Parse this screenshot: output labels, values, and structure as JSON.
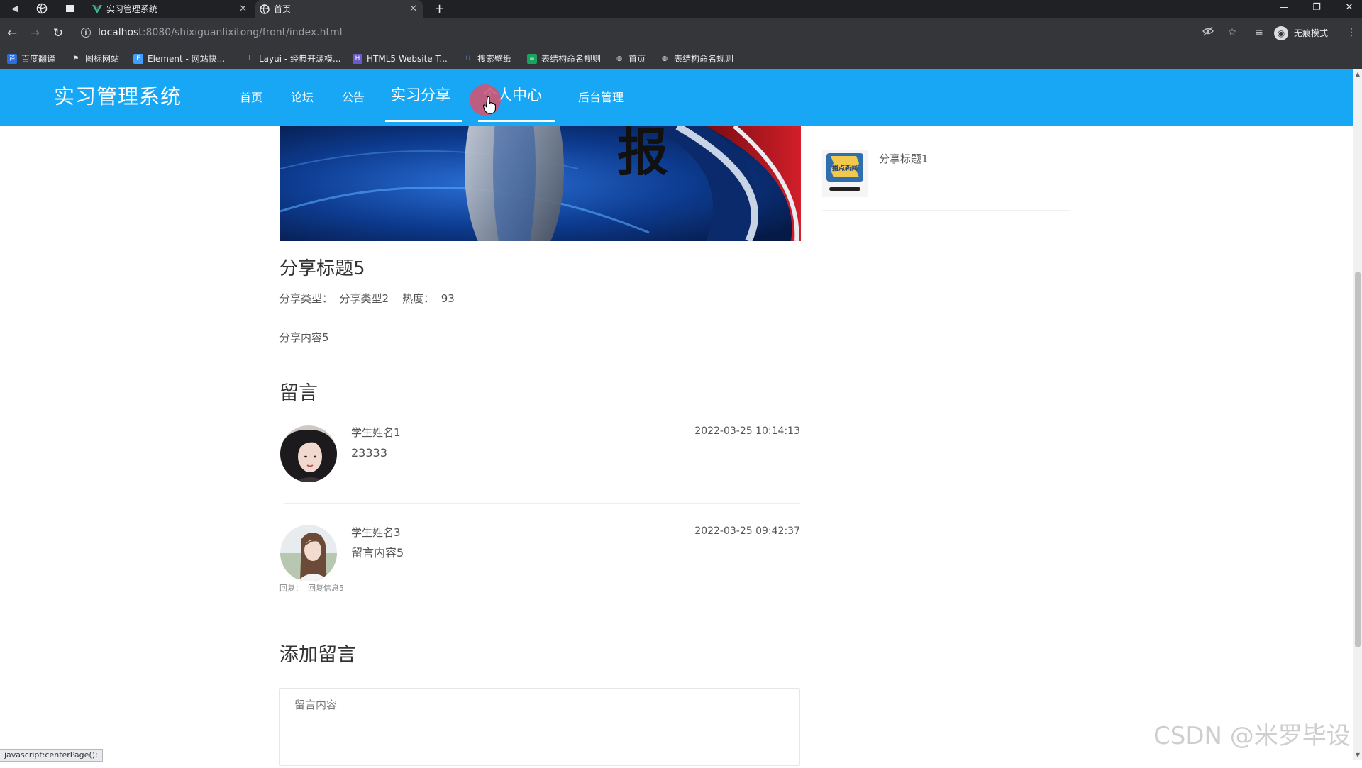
{
  "browser": {
    "tabs": [
      {
        "title": "实习管理系统",
        "active": false
      },
      {
        "title": "首页",
        "active": true
      }
    ],
    "url_host": "localhost",
    "url_path": ":8080/shixiguanlixitong/front/index.html",
    "profile_label": "无痕模式",
    "bookmarks": [
      "百度翻译",
      "图标网站",
      "Element - 网站快...",
      "Layui - 经典开源模...",
      "HTML5 Website T...",
      "搜索壁纸",
      "表结构命名规则",
      "首页",
      "表结构命名规则"
    ]
  },
  "site": {
    "title": "实习管理系统",
    "nav": [
      "首页",
      "论坛",
      "公告",
      "实习分享",
      "个人中心",
      "后台管理"
    ],
    "accent_color": "#17a7f5"
  },
  "post": {
    "title": "分享标题5",
    "meta": "分享类型：  分享类型2    热度：  93",
    "content": "分享内容5",
    "banner_char": "报"
  },
  "comments_section": {
    "title": "留言",
    "comments": [
      {
        "name": "学生姓名1",
        "text": "23333",
        "time": "2022-03-25 10:14:13"
      },
      {
        "name": "学生姓名3",
        "text": "留言内容5",
        "time": "2022-03-25 09:42:37",
        "reply": "回复：  回复信息5"
      }
    ]
  },
  "add_comment": {
    "title": "添加留言",
    "placeholder": "留言内容"
  },
  "sidebar": {
    "items": [
      {
        "title": "分享标题1",
        "thumb_text": "播点新闻"
      }
    ]
  },
  "status_tip": "javascript:centerPage();",
  "watermark": "CSDN @米罗毕设"
}
